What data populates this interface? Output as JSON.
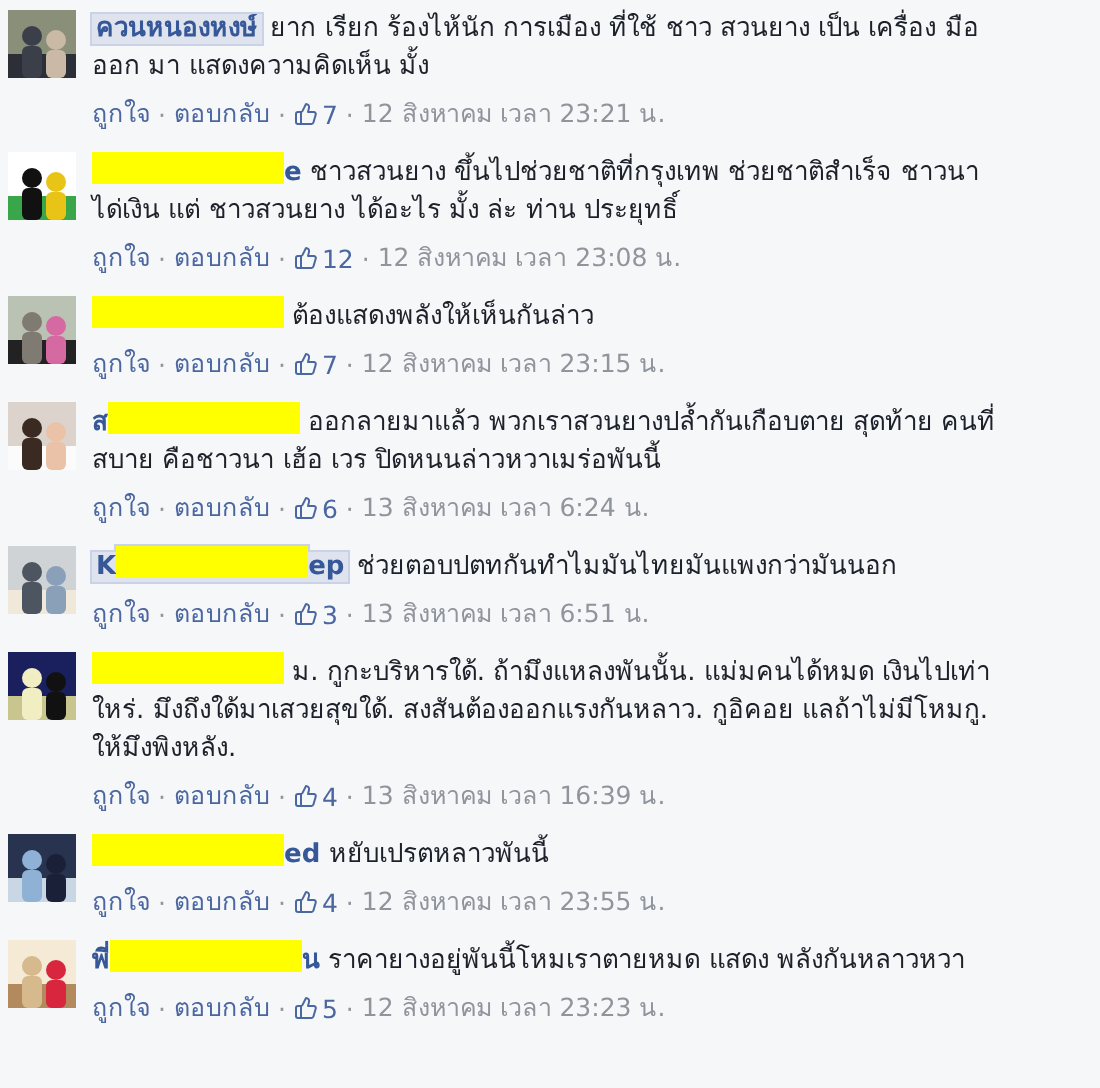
{
  "separator": "·",
  "comments": [
    {
      "name": "ควนหนองหงษ์",
      "redacted": false,
      "highlighted": true,
      "text": "ยาก เรียก ร้องไห้นัก การเมือง ที่ใช้ ชาว สวนยาง เป็น เครื่อง มือ ออก มา แสดงความคิดเห็น มั้ง",
      "like": "ถูกใจ",
      "reply": "ตอบกลับ",
      "likes": "7",
      "time": "12 สิงหาคม เวลา 23:21 น."
    },
    {
      "name_tail": "e",
      "redacted": true,
      "highlighted": false,
      "text": "ชาวสวนยาง ขึ้นไปช่วยชาติที่กรุงเทพ ช่วยชาติสำเร็จ ชาวนา ได่เงิน แต่ ชาวสวนยาง ได้อะไร มั้ง ล่ะ ท่าน ประยุทธิ์",
      "like": "ถูกใจ",
      "reply": "ตอบกลับ",
      "likes": "12",
      "time": "12 สิงหาคม เวลา 23:08 น."
    },
    {
      "redacted": true,
      "highlighted": false,
      "text": "ต้องแสดงพลังให้เห็นกันล่าว",
      "like": "ถูกใจ",
      "reply": "ตอบกลับ",
      "likes": "7",
      "time": "12 สิงหาคม เวลา 23:15 น."
    },
    {
      "name_head": "ส",
      "redacted": true,
      "highlighted": false,
      "text": "ออกลายมาแล้ว พวกเราสวนยางปล้ำกันเกือบตาย สุดท้าย คนที่สบาย คือชาวนา เฮ้อ เวร ปิดหนนล่าวหวาเมร่อพันนี้",
      "like": "ถูกใจ",
      "reply": "ตอบกลับ",
      "likes": "6",
      "time": "13 สิงหาคม เวลา 6:24 น."
    },
    {
      "name_head": "K",
      "name_tail": "ep",
      "redacted": true,
      "highlighted": true,
      "text": "ช่วยตอบปตทกันทำไมมันไทยมันแพงกว่ามันนอก",
      "like": "ถูกใจ",
      "reply": "ตอบกลับ",
      "likes": "3",
      "time": "13 สิงหาคม เวลา 6:51 น."
    },
    {
      "redacted": true,
      "highlighted": false,
      "text": "ม. กูกะบริหารใด้. ถ้ามึงแหลงพันนั้น. แม่มคนได้หมด เงินไปเท่าใหร่. มึงถึงใด้มาเสวยสุขใด้. สงสันต้องออกแรงกันหลาว. กูอิคอย แลถ้าไม่มีโหมกู. ให้มึงพิงหลัง.",
      "like": "ถูกใจ",
      "reply": "ตอบกลับ",
      "likes": "4",
      "time": "13 สิงหาคม เวลา 16:39 น."
    },
    {
      "name_tail": "ed",
      "redacted": true,
      "highlighted": false,
      "text": "หยับเปรตหลาวพันนี้",
      "like": "ถูกใจ",
      "reply": "ตอบกลับ",
      "likes": "4",
      "time": "12 สิงหาคม เวลา 23:55 น."
    },
    {
      "name_head": "พี่",
      "name_tail": "น",
      "redacted": true,
      "highlighted": false,
      "text": "ราคายางอยู่พันนี้โหมเราตายหมด แสดง พลังกันหลาวหวา",
      "like": "ถูกใจ",
      "reply": "ตอบกลับ",
      "likes": "5",
      "time": "12 สิงหาคม เวลา 23:23 น."
    }
  ]
}
